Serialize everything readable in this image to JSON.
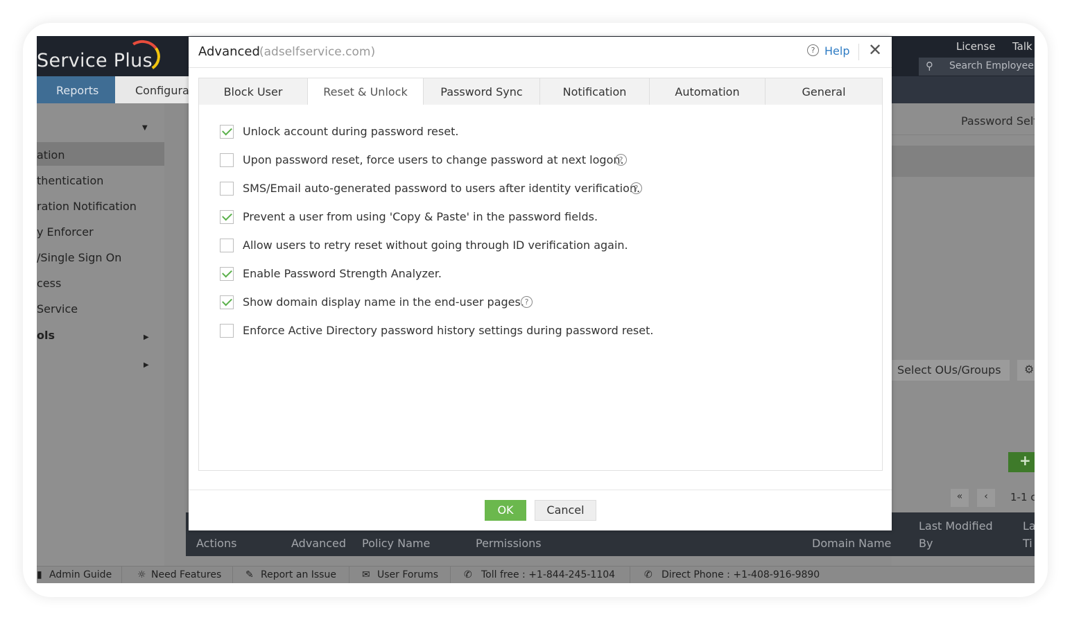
{
  "background": {
    "brand": "Service Plus",
    "top_links": [
      "License",
      "Talk"
    ],
    "search_placeholder": "Search Employee",
    "nav": {
      "reports": "Reports",
      "configuration": "Configurat"
    },
    "sidebar_items": [
      "ation",
      "thentication",
      "ration Notification",
      "y Enforcer",
      "/Single Sign On",
      "cess",
      "Service",
      "ols"
    ],
    "right_labels": {
      "password_self": "Password Self",
      "select_ous": "Select OUs/Groups",
      "pager": "1-1 c"
    },
    "table_headers": [
      "Actions",
      "Advanced",
      "Policy Name",
      "Permissions",
      "Domain Name",
      "Last Modified",
      "By",
      "La",
      "Ti"
    ],
    "footer": [
      "Admin Guide",
      "Need Features",
      "Report an Issue",
      "User Forums",
      "Toll free : +1-844-245-1104",
      "Direct Phone : +1-408-916-9890"
    ]
  },
  "modal": {
    "title": "Advanced",
    "subtitle": "(adselfservice.com)",
    "help_label": "Help",
    "close_glyph": "✕",
    "tabs": [
      "Block User",
      "Reset & Unlock",
      "Password Sync",
      "Notification",
      "Automation",
      "General"
    ],
    "active_tab": "Reset & Unlock",
    "options": [
      {
        "label": "Unlock account during password reset.",
        "checked": true,
        "help": false
      },
      {
        "label": "Upon password reset, force users to change password at next logon.",
        "checked": false,
        "help": true
      },
      {
        "label": "SMS/Email auto-generated password to users after identity verification.",
        "checked": false,
        "help": true
      },
      {
        "label": "Prevent a user from using 'Copy & Paste' in the password fields.",
        "checked": true,
        "help": false
      },
      {
        "label": "Allow users to retry reset without going through ID verification again.",
        "checked": false,
        "help": false
      },
      {
        "label": "Enable Password Strength Analyzer.",
        "checked": true,
        "help": false
      },
      {
        "label": "Show domain display name in the end-user pages.",
        "checked": true,
        "help": true
      },
      {
        "label": "Enforce Active Directory password history settings during password reset.",
        "checked": false,
        "help": false
      }
    ],
    "ok_label": "OK",
    "cancel_label": "Cancel"
  },
  "colors": {
    "accent_green": "#6bb84d",
    "link_blue": "#2f7cc4",
    "check_green": "#5ab04a"
  }
}
